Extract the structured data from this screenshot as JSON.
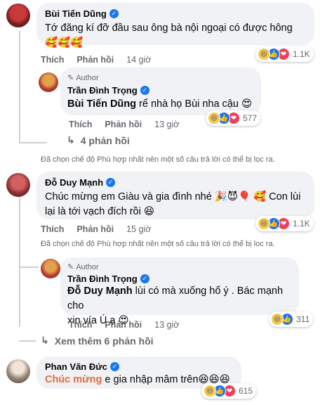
{
  "comments": [
    {
      "author": "Bùi Tiến Dũng",
      "text": "Tớ đăng kí đỡ đầu sau ông bà nội ngoại có được hông",
      "emoji": "🥰🥰🥰",
      "like_label": "Thích",
      "reply_label": "Phản hồi",
      "time": "14 giờ",
      "reaction_count": "1.1K",
      "reply": {
        "author_badge": "Author",
        "author": "Trần Đình Trọng",
        "tag": "Bùi Tiến Dũng",
        "text": " rể nhà họ Bùi nha cậu 😍",
        "like_label": "Thích",
        "reply_label": "Phản hồi",
        "time": "13 giờ",
        "reaction_count": "577"
      },
      "more_replies": "4 phản hồi",
      "filter_note": "Đã chọn chế độ Phù hợp nhất nên một số câu trả lời có thể bị lọc ra."
    },
    {
      "author": "Đỗ Duy Mạnh",
      "text_line1": "Chúc mừng em Giàu và gia đình nhé 🎉😈🎈 🥰 Con lùi",
      "text_line2": "lại là tới vạch đích rồi 😆",
      "like_label": "Thích",
      "reply_label": "Phản hồi",
      "time": "15 giờ",
      "reaction_count": "1.1K",
      "filter_note": "Đã chọn chế độ Phù hợp nhất nên một số câu trả lời có thể bị lọc ra.",
      "reply": {
        "author_badge": "Author",
        "author": "Trần Đình Trọng",
        "tag": "Đỗ Duy Mạnh",
        "text_line1": " lùi có mà xuống hố ý . Bác mạnh cho",
        "text_line2": "xin vía Ú ạ 😍",
        "like_label": "Thích",
        "reply_label": "Phản hồi",
        "time": "13 giờ",
        "reaction_count": "311"
      },
      "more_replies": "Xem thêm 6 phản hồi"
    },
    {
      "author": "Phan Văn Đức",
      "tag": "Chúc mừng",
      "text": " e gia nhập mâm trên😆😆😆",
      "reaction_count": "615"
    }
  ],
  "icons": {
    "verified": "✓",
    "haha": "😆",
    "like": "👍",
    "love": "❤",
    "reply_arrow": "↳",
    "badge": "✎"
  }
}
